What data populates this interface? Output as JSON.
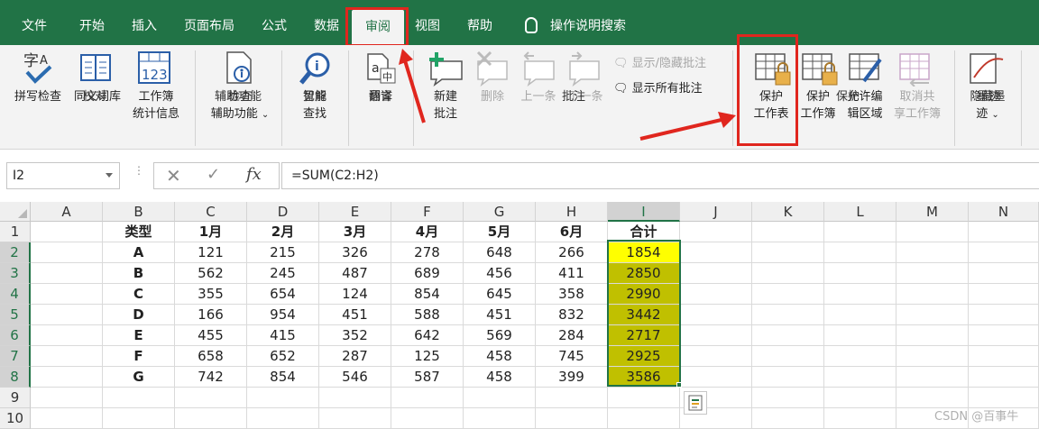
{
  "tabs": [
    "文件",
    "开始",
    "插入",
    "页面布局",
    "公式",
    "数据",
    "审阅",
    "视图",
    "帮助"
  ],
  "active_tab": "审阅",
  "search_label": "操作说明搜索",
  "ribbon": {
    "proofing": {
      "spell": "拼写检查",
      "thesaurus": "同义词库",
      "stats_line1": "工作簿",
      "stats_line2": "统计信息",
      "group": "校对"
    },
    "accessibility": {
      "check_line1": "检查",
      "check_line2": "辅助功能",
      "group": "辅助功能"
    },
    "insights": {
      "smart_line1": "智能",
      "smart_line2": "查找",
      "group": "见解"
    },
    "language": {
      "translate": "翻译",
      "group": "语言"
    },
    "comments": {
      "new_line1": "新建",
      "new_line2": "批注",
      "delete": "删除",
      "prev": "上一条",
      "next": "下一条",
      "show_hide": "显示/隐藏批注",
      "show_all": "显示所有批注",
      "group": "批注"
    },
    "protect": {
      "sheet_line1": "保护",
      "sheet_line2": "工作表",
      "book_line1": "保护",
      "book_line2": "工作簿",
      "edit_line1": "允许编",
      "edit_line2": "辑区域",
      "unshare_line1": "取消共",
      "unshare_line2": "享工作簿",
      "group": "保护"
    },
    "ink": {
      "hide_line1": "隐藏墨",
      "hide_line2": "迹",
      "group": "墨迹"
    }
  },
  "formula_bar": {
    "name_box": "I2",
    "formula": "=SUM(C2:H2)"
  },
  "columns": [
    "A",
    "B",
    "C",
    "D",
    "E",
    "F",
    "G",
    "H",
    "I",
    "J",
    "K",
    "L",
    "M",
    "N"
  ],
  "rows": [
    "1",
    "2",
    "3",
    "4",
    "5",
    "6",
    "7",
    "8",
    "9",
    "10"
  ],
  "header_row": [
    "类型",
    "1月",
    "2月",
    "3月",
    "4月",
    "5月",
    "6月",
    "合计"
  ],
  "data_rows": [
    [
      "A",
      "121",
      "215",
      "326",
      "278",
      "648",
      "266",
      "1854"
    ],
    [
      "B",
      "562",
      "245",
      "487",
      "689",
      "456",
      "411",
      "2850"
    ],
    [
      "C",
      "355",
      "654",
      "124",
      "854",
      "645",
      "358",
      "2990"
    ],
    [
      "D",
      "166",
      "954",
      "451",
      "588",
      "451",
      "832",
      "3442"
    ],
    [
      "E",
      "455",
      "415",
      "352",
      "642",
      "569",
      "284",
      "2717"
    ],
    [
      "F",
      "658",
      "652",
      "287",
      "125",
      "458",
      "745",
      "2925"
    ],
    [
      "G",
      "742",
      "854",
      "546",
      "587",
      "458",
      "399",
      "3586"
    ]
  ],
  "watermark": "CSDN @百事牛",
  "colors": {
    "excel_green": "#217346",
    "highlight_red": "#e0261e",
    "sum_fill": "#c0c000",
    "active_fill": "#ffff00"
  }
}
